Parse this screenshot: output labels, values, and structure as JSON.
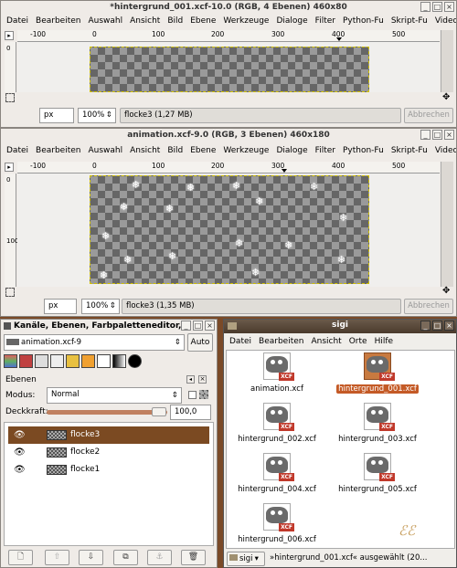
{
  "win1": {
    "title": "*hintergrund_001.xcf-10.0 (RGB, 4 Ebenen) 460x80",
    "unit": "px",
    "zoom": "100%",
    "status": "flocke3 (1,27 MB)",
    "cancel": "Abbrechen"
  },
  "win2": {
    "title": "animation.xcf-9.0 (RGB, 3 Ebenen) 460x180",
    "unit": "px",
    "zoom": "100%",
    "status": "flocke3 (1,35 MB)",
    "cancel": "Abbrechen"
  },
  "menu": [
    "Datei",
    "Bearbeiten",
    "Auswahl",
    "Ansicht",
    "Bild",
    "Ebene",
    "Werkzeuge",
    "Dialoge",
    "Filter",
    "Python-Fu",
    "Skript-Fu",
    "Video"
  ],
  "ruler_labels": [
    "-100",
    "0",
    "100",
    "200",
    "300",
    "400",
    "500"
  ],
  "ruler_v2": [
    "0",
    "100"
  ],
  "layers_panel": {
    "title": "Kanäle, Ebenen, Farbpaletteneditor,",
    "image": "animation.xcf-9",
    "auto": "Auto",
    "section": "Ebenen",
    "mode_label": "Modus:",
    "mode_value": "Normal",
    "opacity_label": "Deckkraft:",
    "opacity_value": "100,0",
    "opacity_level": 1.0,
    "layers": [
      "flocke3",
      "flocke2",
      "flocke1"
    ],
    "selected_layer": "flocke3"
  },
  "filemgr": {
    "title": "sigi",
    "menu": [
      "Datei",
      "Bearbeiten",
      "Ansicht",
      "Orte",
      "Hilfe"
    ],
    "files": [
      "animation.xcf",
      "hintergrund_001.xcf",
      "hintergrund_002.xcf",
      "hintergrund_003.xcf",
      "hintergrund_004.xcf",
      "hintergrund_005.xcf",
      "hintergrund_006.xcf"
    ],
    "selected_file": "hintergrund_001.xcf",
    "location": "sigi",
    "status": "»hintergrund_001.xcf« ausgewählt (20..."
  }
}
